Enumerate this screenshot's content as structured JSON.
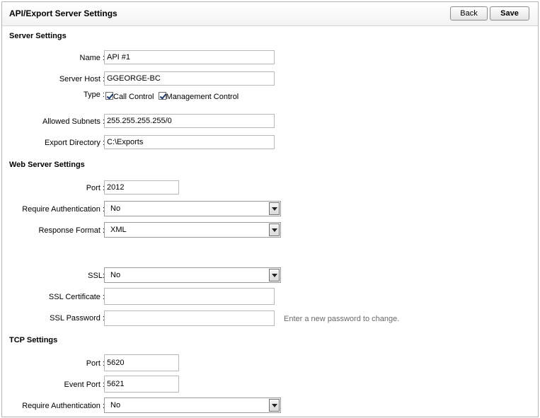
{
  "header": {
    "title": "API/Export Server Settings",
    "back_label": "Back",
    "save_label": "Save"
  },
  "server_settings": {
    "heading": "Server Settings",
    "name": {
      "label": "Name :",
      "value": "API #1"
    },
    "server_host": {
      "label": "Server Host :",
      "value": "GGEORGE-BC"
    },
    "type": {
      "label": "Type :",
      "options": [
        {
          "label": "Call Control",
          "checked": true
        },
        {
          "label": "Management Control",
          "checked": true
        }
      ]
    },
    "allowed_subnets": {
      "label": "Allowed Subnets :",
      "value": "255.255.255.255/0"
    },
    "export_directory": {
      "label": "Export Directory :",
      "value": "C:\\Exports"
    }
  },
  "web_server_settings": {
    "heading": "Web Server Settings",
    "port": {
      "label": "Port :",
      "value": "2012"
    },
    "require_auth": {
      "label": "Require Authentication :",
      "value": "No"
    },
    "response_format": {
      "label": "Response Format :",
      "value": "XML"
    },
    "ssl": {
      "label": "SSL:",
      "value": "No"
    },
    "ssl_certificate": {
      "label": "SSL Certificate :",
      "value": ""
    },
    "ssl_password": {
      "label": "SSL Password :",
      "value": "",
      "hint": "Enter a new password to change."
    }
  },
  "tcp_settings": {
    "heading": "TCP Settings",
    "port": {
      "label": "Port :",
      "value": "5620"
    },
    "event_port": {
      "label": "Event Port :",
      "value": "5621"
    },
    "require_auth": {
      "label": "Require Authentication :",
      "value": "No"
    }
  }
}
